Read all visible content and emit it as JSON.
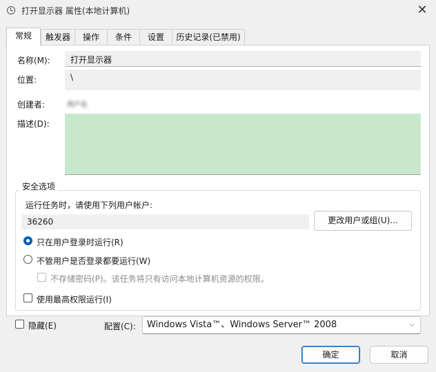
{
  "window": {
    "title": "打开显示器 属性(本地计算机)",
    "close_glyph": "✕"
  },
  "tabs": [
    {
      "label": "常规",
      "active": true
    },
    {
      "label": "触发器"
    },
    {
      "label": "操作"
    },
    {
      "label": "条件"
    },
    {
      "label": "设置"
    },
    {
      "label": "历史记录(已禁用)"
    }
  ],
  "general": {
    "name_label": "名称(M):",
    "name_value": "打开显示器",
    "location_label": "位置:",
    "location_value": "\\",
    "author_label": "创建者:",
    "author_value": "用户名",
    "description_label": "描述(D):",
    "description_value": ""
  },
  "security": {
    "legend": "安全选项",
    "run_as_label": "运行任务时，请使用下列用户帐户:",
    "user_account": "36260",
    "change_user_button": "更改用户或组(U)...",
    "radio_logged_on": "只在用户登录时运行(R)",
    "radio_whether": "不管用户是否登录都要运行(W)",
    "no_store_password": "不存储密码(P)。该任务将只有访问本地计算机资源的权限。",
    "highest_privileges": "使用最高权限运行(I)",
    "selected_radio": "logged_on"
  },
  "bottom": {
    "hidden_label": "隐藏(E)",
    "configure_label": "配置(C):",
    "configure_value": "Windows Vista™、Windows Server™ 2008",
    "ok_button": "确定",
    "cancel_button": "取消"
  },
  "colors": {
    "accent": "#005fb8",
    "description_bg": "#c8e8cc",
    "window_bg": "#f0f0f0"
  }
}
